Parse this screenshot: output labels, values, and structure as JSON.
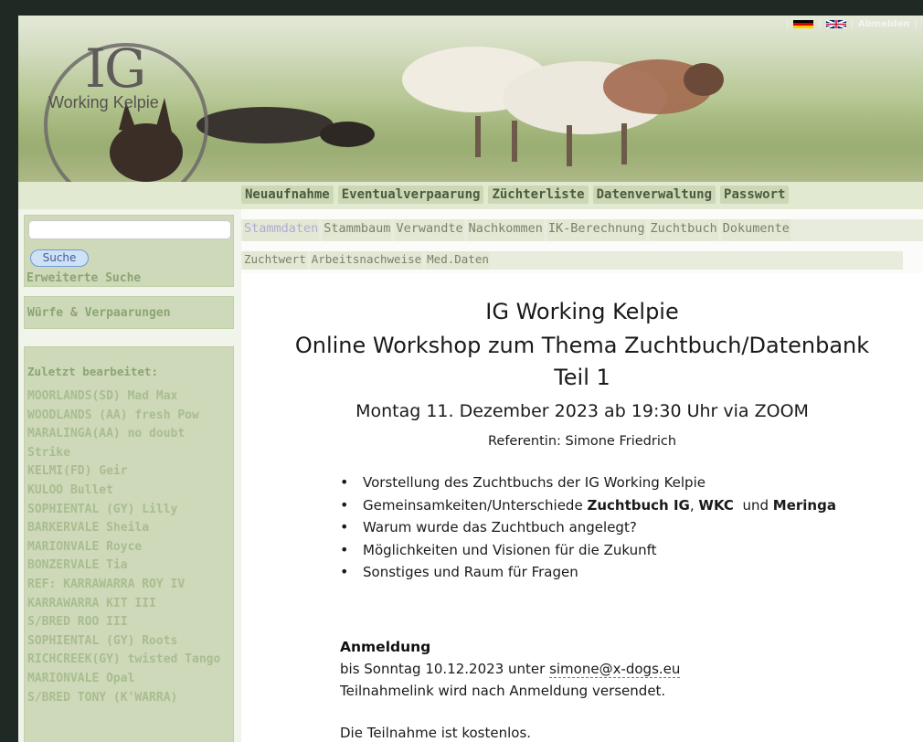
{
  "banner": {
    "logo_main": "IG",
    "logo_sub": "Working Kelpie",
    "logout": "Abmelden",
    "separator": "|"
  },
  "topnav": [
    "Neuaufnahme",
    "Eventualverpaarung",
    "Züchterliste",
    "Datenverwaltung",
    "Passwort"
  ],
  "sidebar": {
    "search_placeholder": "",
    "search_button": "Suche",
    "advanced_search": "Erweiterte Suche",
    "litters": "Würfe & Verpaarungen",
    "recent_title": "Zuletzt bearbeitet:",
    "recent_items": [
      "MOORLANDS(SD) Mad Max",
      "WOODLANDS (AA) fresh Pow",
      "MARALINGA(AA) no doubt Strike",
      "KELMI(FD) Geir",
      "KULOO Bullet",
      "SOPHIENTAL (GY) Lilly",
      "BARKERVALE Sheila",
      "MARIONVALE Royce",
      "BONZERVALE Tia",
      "REF: KARRAWARRA ROY IV",
      "KARRAWARRA KIT III",
      "S/BRED ROO III",
      "SOPHIENTAL (GY) Roots",
      "RICHCREEK(GY) twisted Tango",
      "MARIONVALE Opal",
      "S/BRED TONY (K'WARRA)"
    ]
  },
  "tabs_row1": [
    "Stammdaten",
    "Stammbaum",
    "Verwandte",
    "Nachkommen",
    "IK-Berechnung",
    "Zuchtbuch",
    "Dokumente"
  ],
  "tabs_row2": [
    "Zuchtwert",
    "Arbeitsnachweise",
    "Med.Daten"
  ],
  "active_tab": "Stammdaten",
  "content": {
    "title1": "IG Working Kelpie",
    "title2": "Online Workshop zum Thema Zuchtbuch/Datenbank",
    "title3": "Teil 1",
    "date_line": "Montag 11. Dezember 2023 ab 19:30 Uhr via ZOOM",
    "speaker": "Referentin: Simone Friedrich",
    "bullets": {
      "b1": "Vorstellung des Zuchtbuchs der IG Working Kelpie",
      "b2_pre": "Gemeinsamkeiten/Unterschiede ",
      "b2_bold1": "Zuchtbuch IG",
      "b2_sep": ", ",
      "b2_bold2": "WKC",
      "b2_and": "  und ",
      "b2_bold3": "Meringa",
      "b3": "Warum wurde das Zuchtbuch angelegt?",
      "b4": "Möglichkeiten und Visionen für die Zukunft",
      "b5": "Sonstiges und Raum für Fragen"
    },
    "registration_heading": "Anmeldung",
    "registration_pre": "bis Sonntag 10.12.2023 unter ",
    "registration_email": "simone@x-dogs.eu",
    "registration_note": "Teilnahmelink wird nach Anmeldung versendet.",
    "free_note": "Die Teilnahme ist kostenlos."
  },
  "colors": {
    "banner_green": "#b2c48e",
    "tab_active": "#b3a9d8",
    "sidebar_text": "#8ca573",
    "search_button_border": "#6e9bd4"
  }
}
